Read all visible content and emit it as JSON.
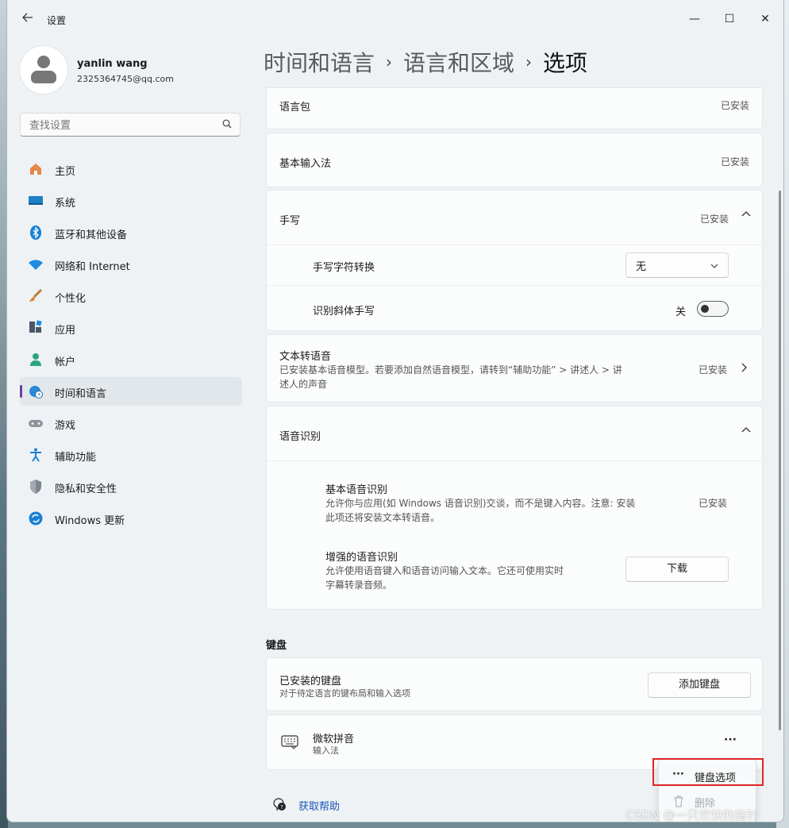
{
  "window": {
    "title": "设置",
    "controls": {
      "minimize": "—",
      "maximize": "☐",
      "close": "✕"
    }
  },
  "profile": {
    "name": "yanlin wang",
    "email": "2325364745@qq.com"
  },
  "search": {
    "placeholder": "查找设置"
  },
  "sidebar": {
    "items": [
      {
        "label": "主页",
        "icon": "home-icon"
      },
      {
        "label": "系统",
        "icon": "monitor-icon"
      },
      {
        "label": "蓝牙和其他设备",
        "icon": "bluetooth-icon"
      },
      {
        "label": "网络和 Internet",
        "icon": "wifi-icon"
      },
      {
        "label": "个性化",
        "icon": "brush-icon"
      },
      {
        "label": "应用",
        "icon": "apps-icon"
      },
      {
        "label": "帐户",
        "icon": "person-icon"
      },
      {
        "label": "时间和语言",
        "icon": "globe-clock-icon",
        "active": true
      },
      {
        "label": "游戏",
        "icon": "gamepad-icon"
      },
      {
        "label": "辅助功能",
        "icon": "accessibility-icon"
      },
      {
        "label": "隐私和安全性",
        "icon": "shield-icon"
      },
      {
        "label": "Windows 更新",
        "icon": "update-icon"
      }
    ]
  },
  "breadcrumb": {
    "level1": "时间和语言",
    "level2": "语言和区域",
    "current": "选项",
    "separator": "›"
  },
  "main": {
    "language_pack": {
      "title": "语言包",
      "status": "已安装"
    },
    "basic_input": {
      "title": "基本输入法",
      "status": "已安装"
    },
    "handwriting": {
      "title": "手写",
      "status": "已安装",
      "char_convert": {
        "label": "手写字符转换",
        "value": "无"
      },
      "italic": {
        "label": "识别斜体手写",
        "state": "关"
      }
    },
    "tts": {
      "title": "文本转语音",
      "desc_line1": "已安装基本语音模型。若要添加自然语音模型，请转到“辅助功能” > 讲述人 > 讲",
      "desc_line2": "述人的声音",
      "status": "已安装"
    },
    "speech": {
      "title": "语音识别",
      "basic": {
        "title": "基本语音识别",
        "desc_line1": "允许你与应用(如 Windows 语音识别)交谈，而不是键入内容。注意: 安装",
        "desc_line2": "此项还将安装文本转语音。",
        "status": "已安装"
      },
      "enhanced": {
        "title": "增强的语音识别",
        "desc_line1": "允许使用语音键入和语音访问输入文本。它还可使用实时",
        "desc_line2": "字幕转录音频。",
        "button": "下载"
      }
    },
    "keyboard": {
      "heading": "键盘",
      "installed": {
        "title": "已安装的键盘",
        "desc": "对于待定语言的键布局和输入选项",
        "button": "添加键盘"
      },
      "item": {
        "name": "微软拼音",
        "type": "输入法",
        "more": "···"
      }
    },
    "context_menu": {
      "items": [
        {
          "label": "键盘选项",
          "icon": "···"
        },
        {
          "label": "删除",
          "icon": "trash-icon"
        }
      ]
    },
    "help_link": "获取帮助"
  },
  "watermark": "CSDN @一只欢快的指针"
}
